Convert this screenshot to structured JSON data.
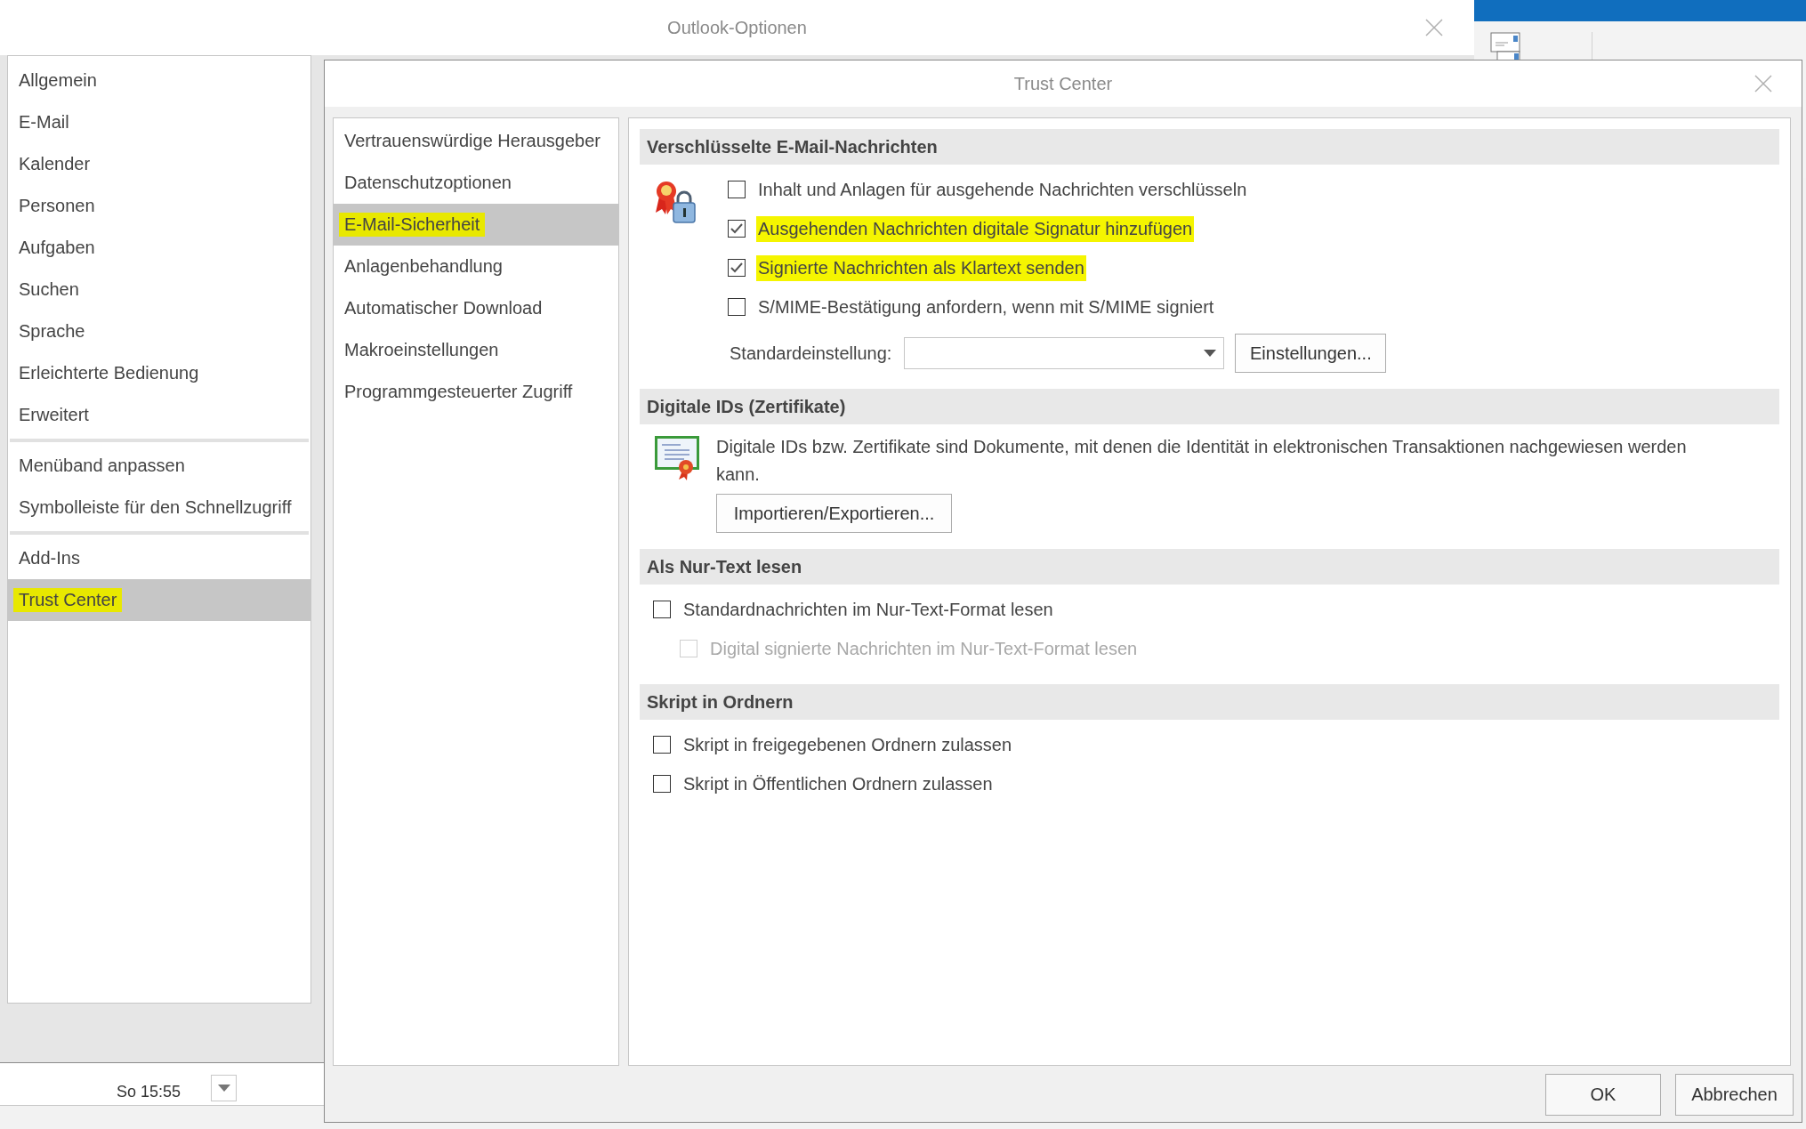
{
  "background_window": {
    "time": "So 15:55"
  },
  "options_window": {
    "title": "Outlook-Optionen",
    "nav_groups": [
      {
        "items": [
          {
            "label": "Allgemein",
            "selected": false,
            "highlighted": false
          },
          {
            "label": "E-Mail",
            "selected": false,
            "highlighted": false
          },
          {
            "label": "Kalender",
            "selected": false,
            "highlighted": false
          },
          {
            "label": "Personen",
            "selected": false,
            "highlighted": false
          },
          {
            "label": "Aufgaben",
            "selected": false,
            "highlighted": false
          },
          {
            "label": "Suchen",
            "selected": false,
            "highlighted": false
          },
          {
            "label": "Sprache",
            "selected": false,
            "highlighted": false
          },
          {
            "label": "Erleichterte Bedienung",
            "selected": false,
            "highlighted": false
          },
          {
            "label": "Erweitert",
            "selected": false,
            "highlighted": false
          }
        ]
      },
      {
        "items": [
          {
            "label": "Menüband anpassen",
            "selected": false,
            "highlighted": false
          },
          {
            "label": "Symbolleiste für den Schnellzugriff",
            "selected": false,
            "highlighted": false
          }
        ]
      },
      {
        "items": [
          {
            "label": "Add-Ins",
            "selected": false,
            "highlighted": false
          },
          {
            "label": "Trust Center",
            "selected": true,
            "highlighted": true
          }
        ]
      }
    ]
  },
  "trust_center": {
    "title": "Trust Center",
    "nav": [
      {
        "label": "Vertrauenswürdige Herausgeber",
        "selected": false,
        "highlighted": false
      },
      {
        "label": "Datenschutzoptionen",
        "selected": false,
        "highlighted": false
      },
      {
        "label": "E-Mail-Sicherheit",
        "selected": true,
        "highlighted": true
      },
      {
        "label": "Anlagenbehandlung",
        "selected": false,
        "highlighted": false
      },
      {
        "label": "Automatischer Download",
        "selected": false,
        "highlighted": false
      },
      {
        "label": "Makroeinstellungen",
        "selected": false,
        "highlighted": false
      },
      {
        "label": "Programmgesteuerter Zugriff",
        "selected": false,
        "highlighted": false
      }
    ],
    "sections": [
      {
        "title": "Verschlüsselte E-Mail-Nachrichten",
        "kind": "seal",
        "rows": [
          {
            "kind": "checkbox",
            "label": "Inhalt und Anlagen für ausgehende Nachrichten verschlüsseln",
            "checked": false,
            "highlighted": false,
            "disabled": false
          },
          {
            "kind": "checkbox",
            "label": "Ausgehenden Nachrichten digitale Signatur hinzufügen",
            "checked": true,
            "highlighted": true,
            "disabled": false
          },
          {
            "kind": "checkbox",
            "label": "Signierte Nachrichten als Klartext senden",
            "checked": true,
            "highlighted": true,
            "disabled": false
          },
          {
            "kind": "checkbox",
            "label": "S/MIME-Bestätigung anfordern, wenn mit S/MIME signiert",
            "checked": false,
            "highlighted": false,
            "disabled": false
          },
          {
            "kind": "select",
            "label": "Standardeinstellung:",
            "button": "Einstellungen..."
          }
        ]
      },
      {
        "title": "Digitale IDs (Zertifikate)",
        "kind": "certificate",
        "rows": [
          {
            "kind": "text",
            "text": "Digitale IDs bzw. Zertifikate sind Dokumente, mit denen die Identität in elektronischen Transaktionen nachgewiesen werden kann."
          },
          {
            "kind": "button",
            "label": "Importieren/Exportieren..."
          }
        ]
      },
      {
        "title": "Als Nur-Text lesen",
        "kind": "plain",
        "rows": [
          {
            "kind": "checkbox",
            "label": "Standardnachrichten im Nur-Text-Format lesen",
            "checked": false,
            "highlighted": false,
            "disabled": false,
            "children": [
              {
                "kind": "checkbox",
                "label": "Digital signierte Nachrichten im Nur-Text-Format lesen",
                "checked": false,
                "highlighted": false,
                "disabled": true
              }
            ]
          }
        ]
      },
      {
        "title": "Skript in Ordnern",
        "kind": "plain",
        "rows": [
          {
            "kind": "checkbox",
            "label": "Skript in freigegebenen Ordnern zulassen",
            "checked": false,
            "highlighted": false,
            "disabled": false
          },
          {
            "kind": "checkbox",
            "label": "Skript in Öffentlichen Ordnern zulassen",
            "checked": false,
            "highlighted": false,
            "disabled": false
          }
        ]
      }
    ],
    "buttons": [
      "OK",
      "Abbrechen"
    ]
  }
}
